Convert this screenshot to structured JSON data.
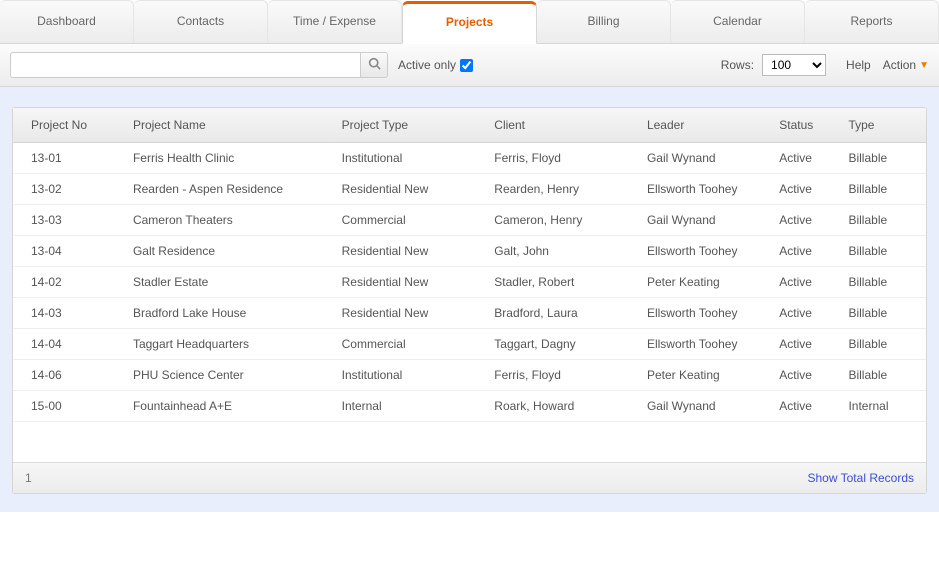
{
  "tabs": [
    {
      "label": "Dashboard"
    },
    {
      "label": "Contacts"
    },
    {
      "label": "Time / Expense"
    },
    {
      "label": "Projects"
    },
    {
      "label": "Billing"
    },
    {
      "label": "Calendar"
    },
    {
      "label": "Reports"
    }
  ],
  "activeTabIndex": 3,
  "toolbar": {
    "search_value": "",
    "active_only_label": "Active only",
    "active_only_checked": true,
    "rows_label": "Rows:",
    "rows_value": "100",
    "help_label": "Help",
    "action_label": "Action"
  },
  "table": {
    "columns": [
      "Project No",
      "Project Name",
      "Project Type",
      "Client",
      "Leader",
      "Status",
      "Type"
    ],
    "rows": [
      {
        "no": "13-01",
        "name": "Ferris Health Clinic",
        "ptype": "Institutional",
        "client": "Ferris, Floyd",
        "leader": "Gail Wynand",
        "status": "Active",
        "btype": "Billable"
      },
      {
        "no": "13-02",
        "name": "Rearden - Aspen Residence",
        "ptype": "Residential New",
        "client": "Rearden, Henry",
        "leader": "Ellsworth Toohey",
        "status": "Active",
        "btype": "Billable"
      },
      {
        "no": "13-03",
        "name": "Cameron Theaters",
        "ptype": "Commercial",
        "client": "Cameron, Henry",
        "leader": "Gail Wynand",
        "status": "Active",
        "btype": "Billable"
      },
      {
        "no": "13-04",
        "name": "Galt Residence",
        "ptype": "Residential New",
        "client": "Galt, John",
        "leader": "Ellsworth Toohey",
        "status": "Active",
        "btype": "Billable"
      },
      {
        "no": "14-02",
        "name": "Stadler Estate",
        "ptype": "Residential New",
        "client": "Stadler, Robert",
        "leader": "Peter Keating",
        "status": "Active",
        "btype": "Billable"
      },
      {
        "no": "14-03",
        "name": "Bradford Lake House",
        "ptype": "Residential New",
        "client": "Bradford, Laura",
        "leader": "Ellsworth Toohey",
        "status": "Active",
        "btype": "Billable"
      },
      {
        "no": "14-04",
        "name": "Taggart Headquarters",
        "ptype": "Commercial",
        "client": "Taggart, Dagny",
        "leader": "Ellsworth Toohey",
        "status": "Active",
        "btype": "Billable"
      },
      {
        "no": "14-06",
        "name": "PHU Science Center",
        "ptype": "Institutional",
        "client": "Ferris, Floyd",
        "leader": "Peter Keating",
        "status": "Active",
        "btype": "Billable"
      },
      {
        "no": "15-00",
        "name": "Fountainhead A+E",
        "ptype": "Internal",
        "client": "Roark, Howard",
        "leader": "Gail Wynand",
        "status": "Active",
        "btype": "Internal"
      }
    ]
  },
  "pager": {
    "page": "1",
    "show_total_label": "Show Total Records"
  }
}
